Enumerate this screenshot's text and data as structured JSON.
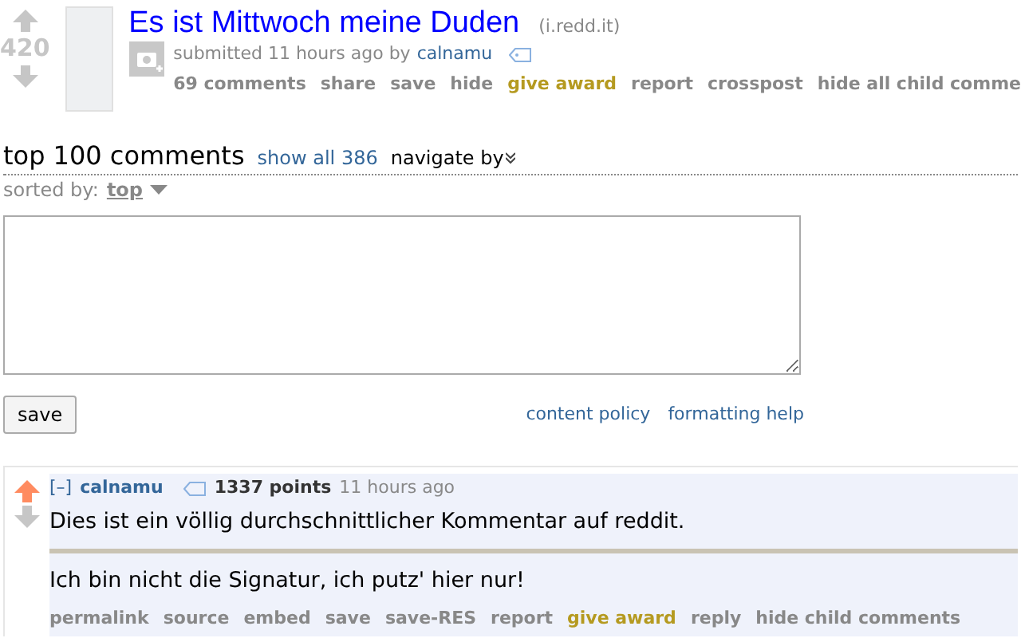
{
  "post": {
    "score": "420",
    "title": "Es ist Mittwoch meine Duden",
    "domain": "(i.redd.it)",
    "submitted": "submitted 11 hours ago by",
    "author": "calnamu",
    "actions": [
      {
        "label": "69 comments",
        "kind": "link"
      },
      {
        "label": "share",
        "kind": "link"
      },
      {
        "label": "save",
        "kind": "link"
      },
      {
        "label": "hide",
        "kind": "link"
      },
      {
        "label": "give award",
        "kind": "award"
      },
      {
        "label": "report",
        "kind": "link"
      },
      {
        "label": "crosspost",
        "kind": "link"
      },
      {
        "label": "hide all child comme",
        "kind": "link"
      }
    ]
  },
  "comments_header": {
    "title": "top 100 comments",
    "show_all": "show all 386",
    "navigate": "navigate by",
    "sorted_label": "sorted by:",
    "sort": "top"
  },
  "reply_form": {
    "save": "save",
    "links": [
      "content policy",
      "formatting help"
    ]
  },
  "comment": {
    "toggle": "[–]",
    "author": "calnamu",
    "points": "1337 points",
    "time": "11 hours ago",
    "upvoted": true,
    "body": "Dies ist ein völlig durchschnittlicher Kommentar auf reddit.",
    "signature": "Ich bin nicht die Signatur, ich putz' hier nur!",
    "actions": [
      {
        "label": "permalink",
        "kind": "link"
      },
      {
        "label": "source",
        "kind": "link"
      },
      {
        "label": "embed",
        "kind": "link"
      },
      {
        "label": "save",
        "kind": "link"
      },
      {
        "label": "save-RES",
        "kind": "link"
      },
      {
        "label": "report",
        "kind": "link"
      },
      {
        "label": "give award",
        "kind": "award"
      },
      {
        "label": "reply",
        "kind": "link"
      },
      {
        "label": "hide child comments",
        "kind": "link"
      }
    ]
  }
}
